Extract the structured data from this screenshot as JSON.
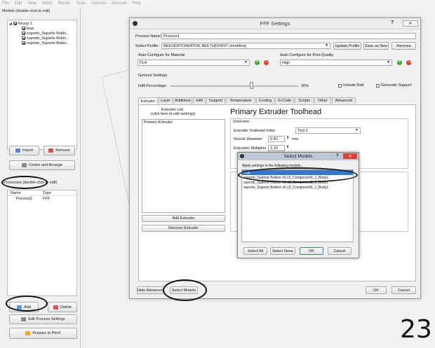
{
  "menu": [
    "File",
    "Edit",
    "View",
    "Mesh",
    "Repair",
    "Tools",
    "Add-Ins",
    "Account",
    "Help"
  ],
  "left": {
    "models_label": "Models (double-click to edit)",
    "tree": [
      {
        "label": "Group 1",
        "level": 0
      },
      {
        "label": "tsup",
        "level": 1
      },
      {
        "label": "suporte_Suporte Bobin...",
        "level": 1
      },
      {
        "label": "suporte_Suporte Bobin...",
        "level": 1
      },
      {
        "label": "suporte_Suporte Bobin...",
        "level": 1
      }
    ],
    "import_btn": "Import",
    "remove_btn": "Remove",
    "center_btn": "Center and Arrange",
    "processes_label": "Processes (double-click to edit)",
    "proc_headers": [
      "Name",
      "Type"
    ],
    "proc_rows": [
      {
        "name": "Process1",
        "type": "FFF"
      }
    ],
    "add_btn": "Add",
    "delete_btn": "Delete",
    "edit_proc_btn": "Edit Process Settings",
    "prepare_btn": "Prepare to Print!"
  },
  "dialog": {
    "title": "FFF Settings",
    "help": "?",
    "process_name_label": "Process Name:",
    "process_name": "Process1",
    "profile_label": "Select Profile:",
    "profile": "BEEVERYCREATIVE BEETHEFIRST (modified)",
    "update_profile": "Update Profile",
    "save_as_new": "Save as New",
    "remove": "Remove",
    "material_label": "Auto-Configure for Material",
    "material": "PLA",
    "quality_label": "Auto-Configure for Print Quality",
    "quality": "High",
    "general_label": "General Settings",
    "infill_label": "Infill Percentage:",
    "infill_value": "30%",
    "infill_fraction": 0.3,
    "include_raft": "Include Raft",
    "gen_support": "Generate Support",
    "tabs": [
      "Extruder",
      "Layer",
      "Additions",
      "Infill",
      "Support",
      "Temperature",
      "Cooling",
      "G-Code",
      "Scripts",
      "Other",
      "Advanced"
    ],
    "extruder_list_label": "Extruder List",
    "extruder_list_hint": "(click item to edit settings)",
    "extruder_item": "Primary Extruder",
    "toolhead_title": "Primary Extruder Toolhead",
    "overview_label": "Overview",
    "toolhead_index_label": "Extruder Toolhead Index",
    "toolhead_index": "Tool 0",
    "nozzle_label": "Nozzle Diameter",
    "nozzle_value": "0,40",
    "nozzle_unit": "mm",
    "multiplier_label": "Extrusion Multiplier",
    "multiplier_value": "1,10",
    "add_extruder": "Add Extruder",
    "remove_extruder": "Remove Extruder",
    "hide_advanced": "Hide Advanced",
    "select_models": "Select Models",
    "ok": "OK",
    "cancel": "Cancel"
  },
  "select_models": {
    "title": "Select Models",
    "help": "?",
    "apply_label": "Apply settings to the following models...",
    "items": [
      "tsup",
      "suporte_Suporte Bobine v5 v3_Component9_1_Body1",
      "suporte_Suporte Bobine v5 v3_Component8_1_Body1",
      "suporte_Suporte Bobine v5 v3_Component5_1_Body1"
    ],
    "select_all": "Select All",
    "select_none": "Select None",
    "ok": "OK",
    "cancel": "Cancel"
  },
  "page_number": "23",
  "colors": {
    "add_green": "#3fa535",
    "remove_red": "#d93a2f",
    "highlight": "#3a77c9",
    "close_red": "#d9413a"
  }
}
